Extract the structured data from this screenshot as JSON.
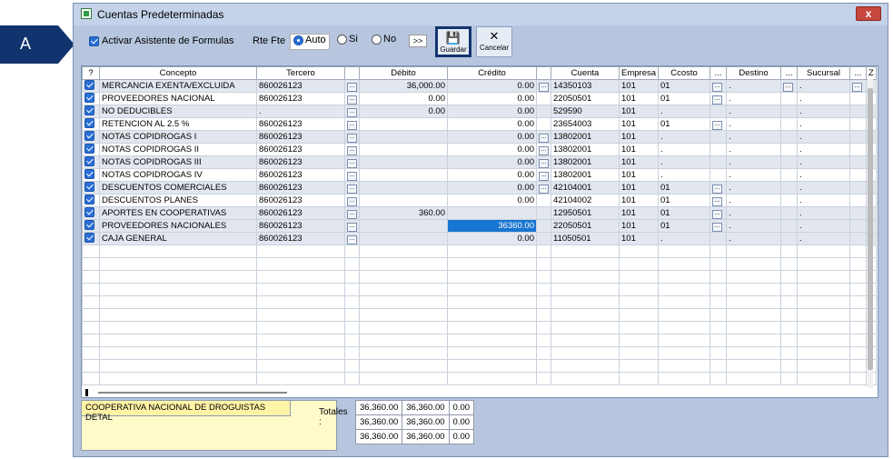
{
  "marker": {
    "label": "A"
  },
  "window": {
    "title": "Cuentas Predeterminadas",
    "close_label": "x"
  },
  "toolbar": {
    "asistente_label": "Activar Asistente de Formulas",
    "rte_label": "Rte Fte",
    "opt_auto": "Auto",
    "opt_si": "Si",
    "opt_no": "No",
    "more_label": ">>",
    "save_label": "Guardar",
    "cancel_label": "Cancelar"
  },
  "grid": {
    "headers": [
      "?",
      "Concepto",
      "Tercero",
      "",
      "Débito",
      "Crédito",
      "",
      "Cuenta",
      "Empresa",
      "Ccosto",
      "...",
      "Destino",
      "...",
      "Sucursal",
      "...",
      "Z"
    ],
    "rows": [
      [
        "MERCANCIA EXENTA/EXCLUIDA",
        "860026123",
        "36,000.00",
        "0.00",
        "14350103",
        "101",
        "01",
        ".",
        "."
      ],
      [
        "PROVEEDORES NACIONAL",
        "860026123",
        "0.00",
        "0.00",
        "22050501",
        "101",
        "01",
        ".",
        "."
      ],
      [
        "NO DEDUCIBLES",
        ".",
        "0.00",
        "0.00",
        "529590",
        "101",
        ".",
        ".",
        "."
      ],
      [
        "RETENCION AL  2.5 %",
        "860026123",
        "",
        "0.00",
        "23654003",
        "101",
        "01",
        ".",
        "."
      ],
      [
        "NOTAS COPIDROGAS I",
        "860026123",
        "",
        "0.00",
        "13802001",
        "101",
        ".",
        ".",
        "."
      ],
      [
        "NOTAS COPIDROGAS II",
        "860026123",
        "",
        "0.00",
        "13802001",
        "101",
        ".",
        ".",
        "."
      ],
      [
        "NOTAS COPIDROGAS III",
        "860026123",
        "",
        "0.00",
        "13802001",
        "101",
        ".",
        ".",
        "."
      ],
      [
        "NOTAS COPIDROGAS IV",
        "860026123",
        "",
        "0.00",
        "13802001",
        "101",
        ".",
        ".",
        "."
      ],
      [
        "DESCUENTOS COMERCIALES",
        "860026123",
        "",
        "0.00",
        "42104001",
        "101",
        "01",
        ".",
        "."
      ],
      [
        "DESCUENTOS PLANES",
        "860026123",
        "",
        "0.00",
        "42104002",
        "101",
        "01",
        ".",
        "."
      ],
      [
        "APORTES EN COOPERATIVAS",
        "860026123",
        "360.00",
        "",
        "12950501",
        "101",
        "01",
        ".",
        "."
      ],
      [
        "PROVEEDORES NACIONALES",
        "860026123",
        "",
        "36360.00",
        "22050501",
        "101",
        "01",
        ".",
        "."
      ],
      [
        "CAJA GENERAL",
        "860026123",
        "",
        "0.00",
        "11050501",
        "101",
        ".",
        ".",
        "."
      ]
    ]
  },
  "footer": {
    "cliente": "COOPERATIVA NACIONAL DE DROGUISTAS DETAL",
    "totales_label": "Totales :",
    "totals": [
      [
        "36,360.00",
        "36,360.00",
        "0.00"
      ],
      [
        "36,360.00",
        "36,360.00",
        "0.00"
      ],
      [
        "36,360.00",
        "36,360.00",
        "0.00"
      ]
    ]
  },
  "colors": {
    "accent": "#2a6fd6",
    "selected_cell": "#1875d1",
    "window_bg": "#b7c6de",
    "marker": "#12346e"
  }
}
